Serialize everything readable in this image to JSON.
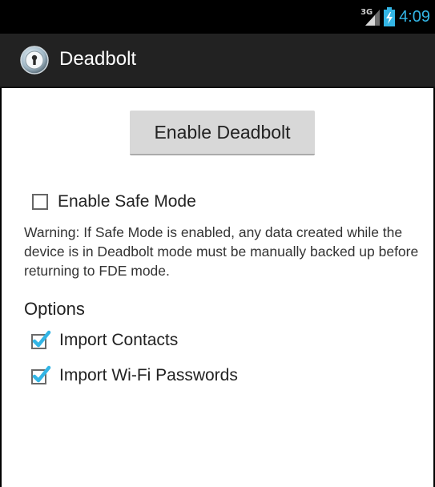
{
  "status_bar": {
    "network": "3G",
    "time": "4:09",
    "signal_icon": "cell-signal-icon",
    "battery_icon": "battery-charging-icon"
  },
  "action_bar": {
    "title": "Deadbolt",
    "icon": "deadbolt-lock-icon"
  },
  "main": {
    "enable_button_label": "Enable Deadbolt",
    "safe_mode": {
      "label": "Enable Safe Mode",
      "checked": false
    },
    "warning_text": "Warning: If Safe Mode is enabled, any data created while the device is in Deadbolt mode must be manually backed up before returning to FDE mode.",
    "options_heading": "Options",
    "options": [
      {
        "label": "Import Contacts",
        "checked": true
      },
      {
        "label": "Import Wi-Fi Passwords",
        "checked": true
      }
    ]
  },
  "colors": {
    "accent": "#33b5e5",
    "status_bar": "#000000",
    "action_bar": "#222222",
    "button": "#d8d8d8"
  }
}
